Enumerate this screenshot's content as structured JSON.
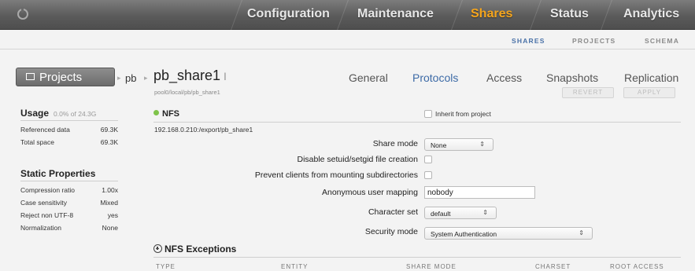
{
  "topnav": {
    "tabs": [
      "Configuration",
      "Maintenance",
      "Shares",
      "Status",
      "Analytics"
    ],
    "active": "Shares"
  },
  "subnav": {
    "items": [
      "SHARES",
      "PROJECTS",
      "SCHEMA"
    ],
    "active": "SHARES"
  },
  "header": {
    "projects_button": "Projects",
    "breadcrumb_project": "pb",
    "share_name": "pb_share1",
    "share_path": "pool0/local/pb/pb_share1",
    "tabs": [
      "General",
      "Protocols",
      "Access",
      "Snapshots",
      "Replication"
    ],
    "active_tab": "Protocols",
    "revert": "REVERT",
    "apply": "APPLY"
  },
  "usage": {
    "title": "Usage",
    "summary": "0.0% of 24.3G",
    "rows": [
      {
        "label": "Referenced data",
        "value": "69.3K"
      },
      {
        "label": "Total space",
        "value": "69.3K"
      }
    ]
  },
  "static_props": {
    "title": "Static Properties",
    "rows": [
      {
        "label": "Compression ratio",
        "value": "1.00x"
      },
      {
        "label": "Case sensitivity",
        "value": "Mixed"
      },
      {
        "label": "Reject non UTF-8",
        "value": "yes"
      },
      {
        "label": "Normalization",
        "value": "None"
      }
    ]
  },
  "nfs": {
    "title": "NFS",
    "inherit_label": "Inherit from project",
    "export_path": "192.168.0.210:/export/pb_share1",
    "share_mode_label": "Share mode",
    "share_mode_value": "None",
    "disable_setuid_label": "Disable setuid/setgid file creation",
    "prevent_mount_label": "Prevent clients from mounting subdirectories",
    "anon_label": "Anonymous user mapping",
    "anon_value": "nobody",
    "charset_label": "Character set",
    "charset_value": "default",
    "security_label": "Security mode",
    "security_value": "System Authentication"
  },
  "exceptions": {
    "title": "NFS Exceptions",
    "columns": [
      "TYPE",
      "ENTITY",
      "SHARE MODE",
      "CHARSET",
      "ROOT ACCESS"
    ]
  }
}
